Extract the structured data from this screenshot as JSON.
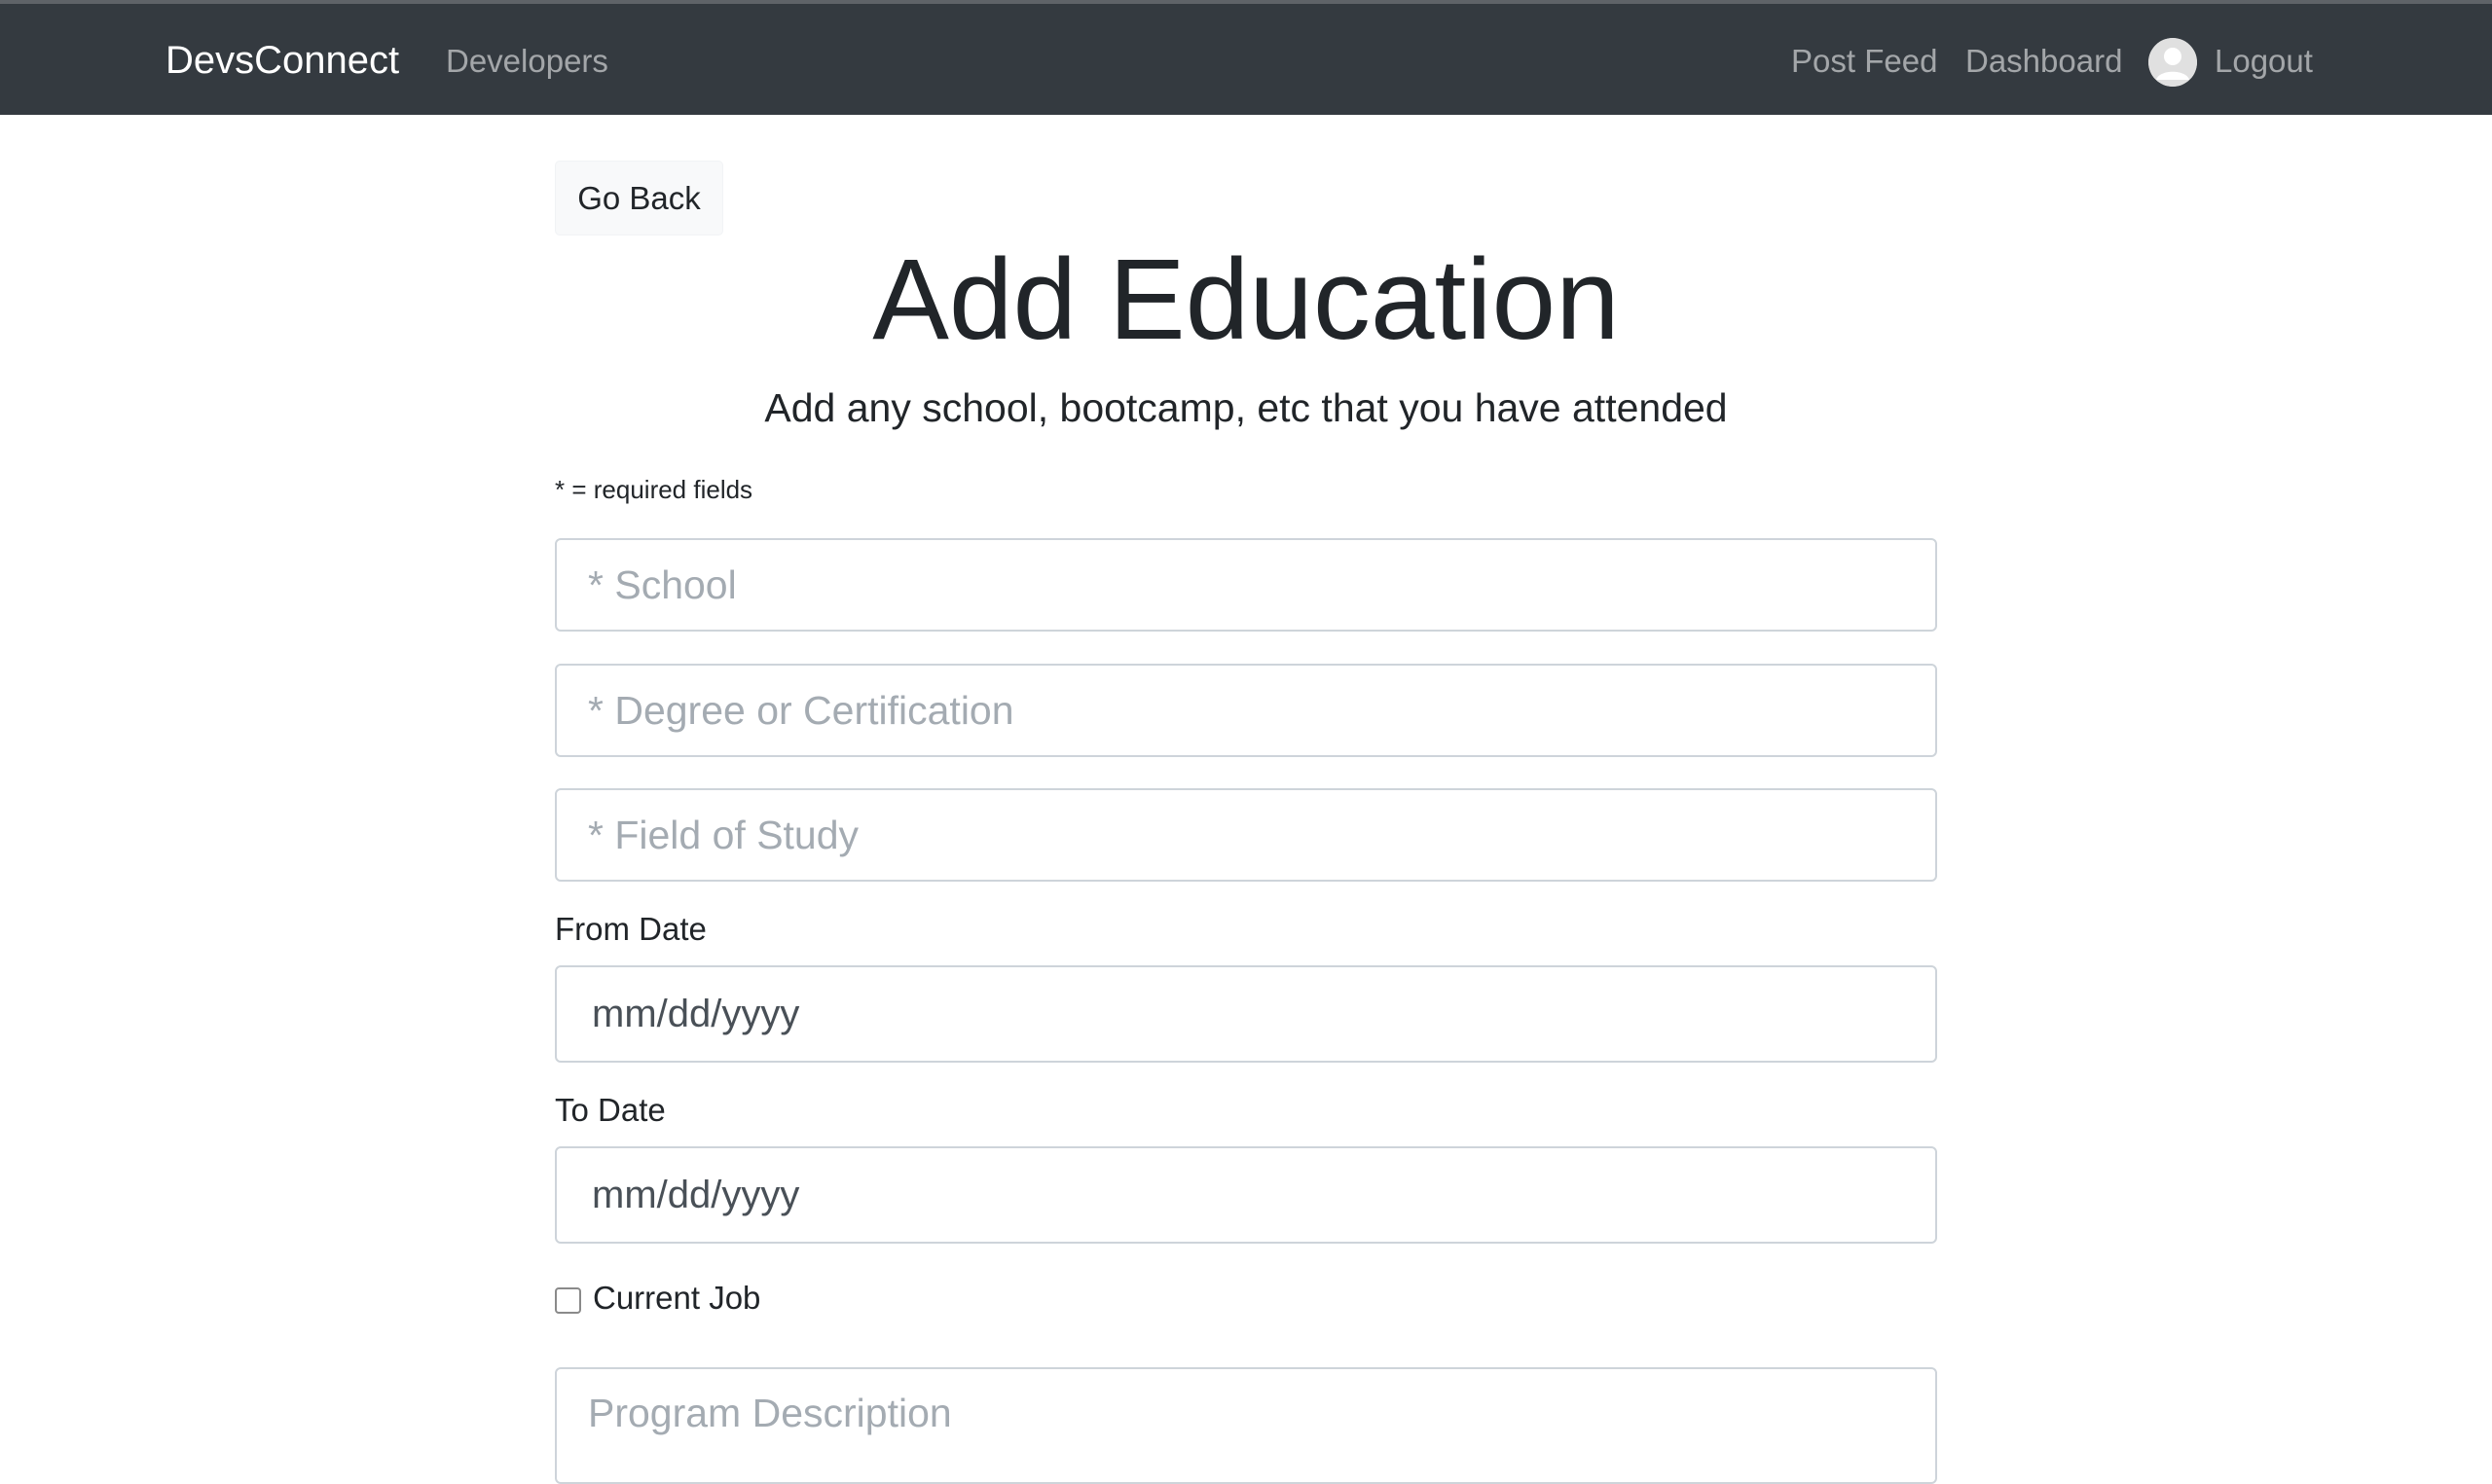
{
  "navbar": {
    "brand": "DevsConnect",
    "developers": "Developers",
    "post_feed": "Post Feed",
    "dashboard": "Dashboard",
    "logout": "Logout",
    "avatar_icon": "user-avatar-icon"
  },
  "main": {
    "go_back": "Go Back",
    "title": "Add Education",
    "lead": "Add any school, bootcamp, etc that you have attended",
    "required_note": "* = required fields"
  },
  "form": {
    "school_placeholder": "* School",
    "degree_placeholder": "* Degree or Certification",
    "field_placeholder": "* Field of Study",
    "from_label": "From Date",
    "from_value": "mm/dd/yyyy",
    "to_label": "To Date",
    "to_value": "mm/dd/yyyy",
    "current_label": "Current Job",
    "current_checked": false,
    "description_placeholder": "Program Description"
  },
  "colors": {
    "navbar_bg": "#343a40",
    "brand_text": "#ffffff",
    "nav_link": "rgba(255,255,255,0.55)",
    "placeholder": "#a4abb2",
    "border": "#ced4da"
  }
}
